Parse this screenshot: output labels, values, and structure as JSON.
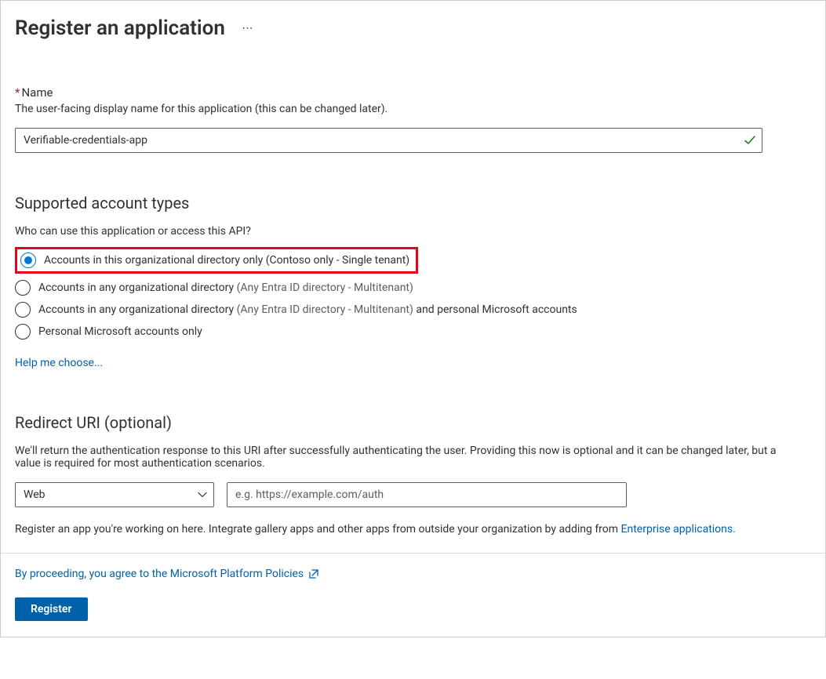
{
  "header": {
    "title": "Register an application",
    "more_label": "⋯"
  },
  "name_section": {
    "required_marker": "*",
    "label": "Name",
    "description": "The user-facing display name for this application (this can be changed later).",
    "value": "Verifiable-credentials-app"
  },
  "account_types": {
    "title": "Supported account types",
    "question": "Who can use this application or access this API?",
    "options": [
      {
        "label": "Accounts in this organizational directory only (Contoso only - Single tenant)",
        "selected": true
      },
      {
        "label_pre": "Accounts in any organizational directory ",
        "label_gray": "(Any Entra ID directory - Multitenant)",
        "label_post": "",
        "selected": false
      },
      {
        "label_pre": "Accounts in any organizational directory ",
        "label_gray": "(Any Entra ID directory - Multitenant)",
        "label_post": "  and personal Microsoft accounts",
        "selected": false
      },
      {
        "label": "Personal Microsoft accounts only",
        "selected": false
      }
    ],
    "help_link": "Help me choose..."
  },
  "redirect": {
    "title": "Redirect URI (optional)",
    "description": "We'll return the authentication response to this URI after successfully authenticating the user. Providing this now is optional and it can be changed later, but a value is required for most authentication scenarios.",
    "platform": "Web",
    "uri_placeholder": "e.g. https://example.com/auth",
    "uri_value": ""
  },
  "footer_note_pre": "Register an app you're working on here. Integrate gallery apps and other apps from outside your organization by adding from ",
  "footer_note_link": "Enterprise applications.",
  "agree_text": "By proceeding, you agree to the Microsoft Platform Policies",
  "register_label": "Register"
}
